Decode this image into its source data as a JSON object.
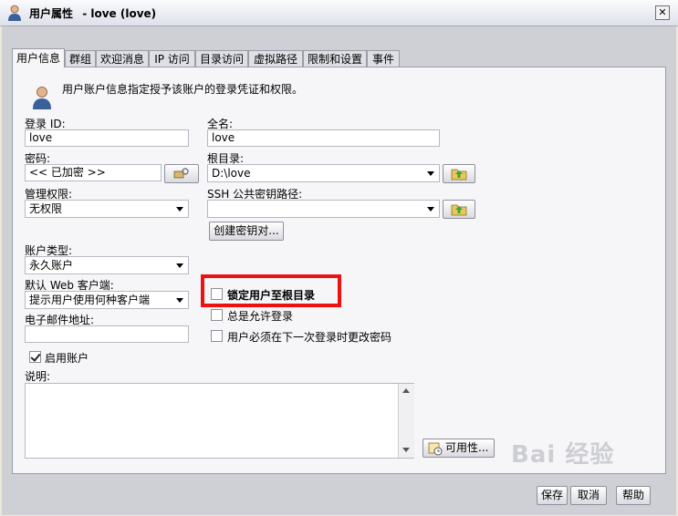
{
  "window": {
    "title": "用户属性",
    "subtitle": "- love (love)",
    "close_glyph": "✕"
  },
  "tabs": [
    {
      "label": "用户信息",
      "active": true
    },
    {
      "label": "群组"
    },
    {
      "label": "欢迎消息"
    },
    {
      "label": "IP 访问"
    },
    {
      "label": "目录访问"
    },
    {
      "label": "虚拟路径"
    },
    {
      "label": "限制和设置"
    },
    {
      "label": "事件"
    }
  ],
  "intro_text": "用户账户信息指定授予该账户的登录凭证和权限。",
  "form": {
    "login_id": {
      "label": "登录 ID:",
      "value": "love"
    },
    "full_name": {
      "label": "全名:",
      "value": "love"
    },
    "password": {
      "label": "密码:",
      "value": "<< 已加密 >>"
    },
    "root_dir": {
      "label": "根目录:",
      "value": "D:\\love"
    },
    "admin_rights": {
      "label": "管理权限:",
      "value": "无权限"
    },
    "ssh_key_path": {
      "label": "SSH 公共密钥路径:",
      "value": ""
    },
    "create_key_button": "创建密钥对...",
    "account_type": {
      "label": "账户类型:",
      "value": "永久账户"
    },
    "web_client": {
      "label": "默认 Web 客户端:",
      "value": "提示用户使用何种客户端"
    },
    "email": {
      "label": "电子邮件地址:",
      "value": ""
    },
    "enable_account": {
      "label": "启用账户",
      "checked": true
    },
    "lock_root": {
      "label": "锁定用户至根目录",
      "checked": false
    },
    "always_allow_login": {
      "label": "总是允许登录",
      "checked": false
    },
    "must_change_password": {
      "label": "用户必须在下一次登录时更改密码",
      "checked": false
    },
    "description": {
      "label": "说明:",
      "value": ""
    },
    "availability_button": "可用性..."
  },
  "footer": {
    "save": "保存",
    "cancel": "取消",
    "help": "帮助"
  },
  "watermark": "Bai 经验",
  "colors": {
    "highlight": "#ee1111",
    "panel": "#cfd0d6",
    "content": "#f6f6f8"
  }
}
